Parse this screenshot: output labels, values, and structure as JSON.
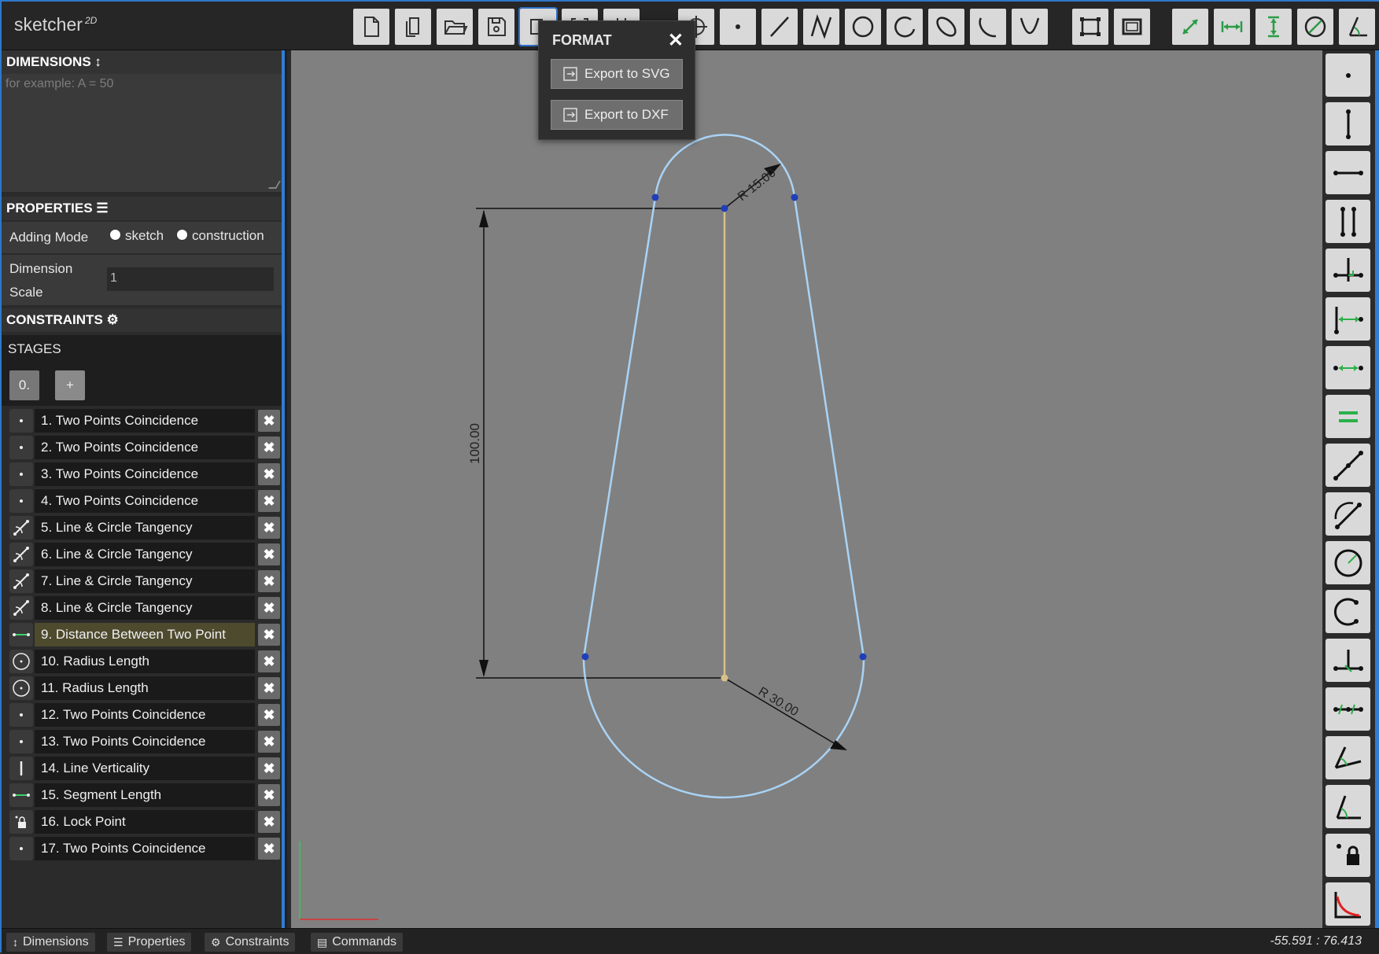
{
  "app": {
    "name": "sketcher",
    "superscript": "2D"
  },
  "toolbar": {
    "buttons": [
      "new-file-icon",
      "copy-file-icon",
      "open-folder-icon",
      "save-icon",
      "export-icon",
      "fit-icon",
      "grid-icon",
      "crosshair-icon",
      "point-icon",
      "line-icon",
      "polyline-icon",
      "circle-icon",
      "arc-icon",
      "ellipse-icon",
      "elliptic-arc-icon",
      "parabola-icon",
      "select-box-icon",
      "frame-icon",
      "aligned-dimension-icon",
      "horizontal-dimension-icon",
      "vertical-dimension-icon",
      "diameter-dimension-icon",
      "angle-dimension-icon"
    ]
  },
  "panels": {
    "dimensions": {
      "title": "DIMENSIONS",
      "placeholder": "for example: A = 50"
    },
    "properties": {
      "title": "PROPERTIES",
      "adding_mode_label": "Adding Mode",
      "option_sketch": "sketch",
      "option_construction": "construction",
      "dimension_scale_label_1": "Dimension",
      "dimension_scale_label_2": "Scale",
      "dimension_scale_value": "1"
    },
    "constraints": {
      "title": "CONSTRAINTS"
    },
    "stages": {
      "title": "STAGES",
      "stage_0": "0.",
      "add_label": "+"
    }
  },
  "constraints_list": [
    {
      "label": "1. Two Points Coincidence",
      "icon": "coincidence-icon"
    },
    {
      "label": "2. Two Points Coincidence",
      "icon": "coincidence-icon"
    },
    {
      "label": "3. Two Points Coincidence",
      "icon": "coincidence-icon"
    },
    {
      "label": "4. Two Points Coincidence",
      "icon": "coincidence-icon"
    },
    {
      "label": "5. Line & Circle Tangency",
      "icon": "tangency-icon"
    },
    {
      "label": "6. Line & Circle Tangency",
      "icon": "tangency-icon"
    },
    {
      "label": "7. Line & Circle Tangency",
      "icon": "tangency-icon"
    },
    {
      "label": "8. Line & Circle Tangency",
      "icon": "tangency-icon"
    },
    {
      "label": "9. Distance Between Two Point",
      "icon": "distance-icon",
      "highlighted": true
    },
    {
      "label": "10. Radius Length",
      "icon": "radius-icon"
    },
    {
      "label": "11. Radius Length",
      "icon": "radius-icon"
    },
    {
      "label": "12. Two Points Coincidence",
      "icon": "coincidence-icon"
    },
    {
      "label": "13. Two Points Coincidence",
      "icon": "coincidence-icon"
    },
    {
      "label": "14. Line Verticality",
      "icon": "verticality-icon"
    },
    {
      "label": "15. Segment Length",
      "icon": "distance-icon"
    },
    {
      "label": "16. Lock Point",
      "icon": "lock-icon"
    },
    {
      "label": "17. Two Points Coincidence",
      "icon": "coincidence-icon"
    }
  ],
  "delete_glyph": "✖",
  "canvas": {
    "dim_vertical": "100.00",
    "dim_radius_small": "R 15.00",
    "dim_radius_large": "R 30.00"
  },
  "format_popup": {
    "title": "FORMAT",
    "close": "✕",
    "export_svg": "Export to SVG",
    "export_dxf": "Export to DXF"
  },
  "rightbar": {
    "buttons": [
      "fix-point-icon",
      "vertical-icon",
      "horizontal-icon",
      "parallel-icon",
      "perpendicular-icon",
      "horizontal-distance-icon",
      "distance-icon",
      "equal-icon",
      "point-on-line-icon",
      "tangent-icon",
      "radius-icon",
      "arc-icon",
      "midpoint-icon",
      "symmetry-icon",
      "angle-icon",
      "angle-horizontal-icon",
      "lock-icon",
      "fillet-icon"
    ]
  },
  "bottombar": {
    "tabs": [
      {
        "label": "Dimensions",
        "glyph": "↕"
      },
      {
        "label": "Properties",
        "glyph": "☰"
      },
      {
        "label": "Constraints",
        "glyph": "⚙"
      },
      {
        "label": "Commands",
        "glyph": "▤"
      }
    ],
    "coords": "-55.591 : 76.413"
  },
  "colors": {
    "accent": "#2f7dd3",
    "sketch_line": "#a9d3f5",
    "construction_line": "#d8c08a",
    "point": "#1f3fb8",
    "canvas_bg": "#808080"
  }
}
